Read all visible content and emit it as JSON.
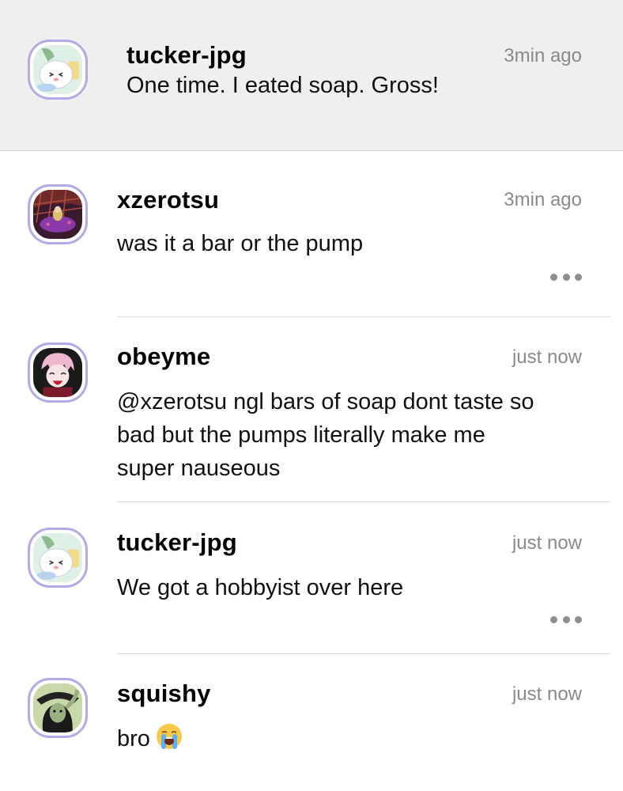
{
  "op": {
    "username": "tucker-jpg",
    "time": "3min ago",
    "text": "One time. I eated soap. Gross!",
    "avatar_icon": "character-avatar-icon"
  },
  "replies": [
    {
      "username": "xzerotsu",
      "time": "3min ago",
      "text": "was it a bar or the pump",
      "has_more": true
    },
    {
      "username": "obeyme",
      "time": "just now",
      "lines": [
        "@xzerotsu ngl bars of soap dont taste so",
        "bad but the pumps literally make me",
        "super nauseous"
      ]
    },
    {
      "username": "tucker-jpg",
      "time": "just now",
      "text": "We got a hobbyist over here",
      "has_more": true
    },
    {
      "username": "squishy",
      "time": "just now",
      "text": "bro",
      "emoji": "loudly-crying-face"
    }
  ],
  "colors": {
    "highlight_bg": "#efefef",
    "avatar_border": "#b7a8e6",
    "timestamp": "#8a8a8e"
  }
}
